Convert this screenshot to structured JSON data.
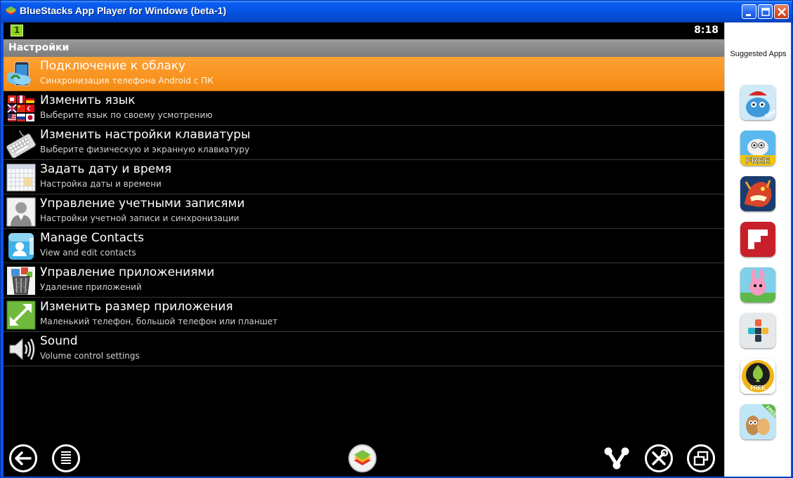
{
  "window": {
    "title": "BlueStacks App Player for Windows (beta-1)"
  },
  "statusbar": {
    "notification": "1",
    "time": "8:18"
  },
  "header": {
    "title": "Настройки"
  },
  "settings": [
    {
      "title": "Подключение к облаку",
      "subtitle": "Синхронизация телефона Android с ПК",
      "icon": "cloud-phone-icon",
      "selected": true
    },
    {
      "title": "Изменить язык",
      "subtitle": "Выберите язык по своему усмотрению",
      "icon": "flags-icon"
    },
    {
      "title": "Изменить настройки клавиатуры",
      "subtitle": "Выберите физическую и экранную клавиатуру",
      "icon": "keyboard-icon"
    },
    {
      "title": "Задать дату и время",
      "subtitle": "Настройка даты и времени",
      "icon": "calendar-icon"
    },
    {
      "title": "Управление учетными записями",
      "subtitle": "Настройки учетной записи и синхронизации",
      "icon": "account-icon"
    },
    {
      "title": "Manage Contacts",
      "subtitle": "View and edit contacts",
      "icon": "contacts-icon"
    },
    {
      "title": "Управление приложениями",
      "subtitle": "Удаление приложений",
      "icon": "trash-icon"
    },
    {
      "title": "Изменить размер приложения",
      "subtitle": "Маленький телефон, большой телефон или планшет",
      "icon": "resize-icon"
    },
    {
      "title": "Sound",
      "subtitle": "Volume control settings",
      "icon": "speaker-icon"
    }
  ],
  "sidebar": {
    "title": "Suggested Apps",
    "apps": [
      "app-1",
      "app-2",
      "app-3",
      "app-4",
      "app-5",
      "app-6",
      "app-7",
      "app-8"
    ],
    "app_badges": {
      "app-1": "free",
      "app-2": "FREE",
      "app-7": "FREE",
      "app-8": "FREE"
    }
  },
  "colors": {
    "selected_row": "#f48a12",
    "titlebar": "#0554e3",
    "header": "#8a8a8a"
  }
}
